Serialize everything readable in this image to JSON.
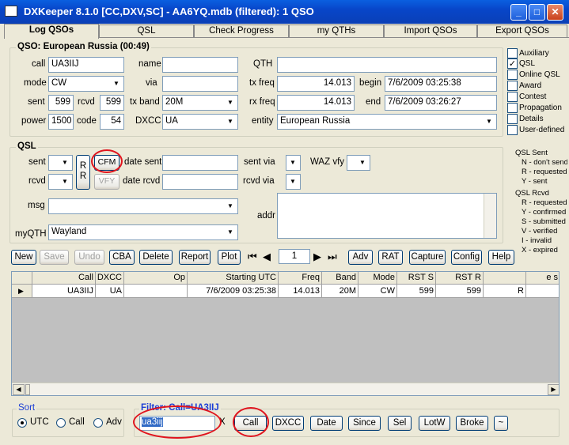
{
  "window": {
    "title": "DXKeeper 8.1.0 [CC,DXV,SC] - AA6YQ.mdb (filtered): 1 QSO"
  },
  "tabs": [
    "Log QSOs",
    "QSL",
    "Check Progress",
    "my QTHs",
    "Import QSOs",
    "Export QSOs"
  ],
  "qso": {
    "group_title": "QSO: European Russia (00:49)",
    "call_label": "call",
    "call": "UA3IIJ",
    "name_label": "name",
    "name": "",
    "qth_label": "QTH",
    "qth": "",
    "mode_label": "mode",
    "mode": "CW",
    "via_label": "via",
    "via": "",
    "txfreq_label": "tx freq",
    "txfreq": "14.013",
    "begin_label": "begin",
    "begin": "7/6/2009   03:25:38",
    "sent_label": "sent",
    "sent": "599",
    "rcvd_label": "rcvd",
    "rcvd": "599",
    "txband_label": "tx band",
    "txband": "20M",
    "rxfreq_label": "rx freq",
    "rxfreq": "14.013",
    "end_label": "end",
    "end": "7/6/2009   03:26:27",
    "power_label": "power",
    "power": "1500",
    "code_label": "code",
    "code": "54",
    "dxcc_label": "DXCC",
    "dxcc": "UA",
    "entity_label": "entity",
    "entity": "European Russia"
  },
  "checkboxes": [
    {
      "label": "Auxiliary",
      "checked": false
    },
    {
      "label": "QSL",
      "checked": true
    },
    {
      "label": "Online QSL",
      "checked": false
    },
    {
      "label": "Award",
      "checked": false
    },
    {
      "label": "Contest",
      "checked": false
    },
    {
      "label": "Propagation",
      "checked": false
    },
    {
      "label": "Details",
      "checked": false
    },
    {
      "label": "User-defined",
      "checked": false
    }
  ],
  "qsl": {
    "group_title": "QSL",
    "sent_label": "sent",
    "rcvd_label": "rcvd",
    "rr_label": "R R",
    "cfm": "CFM",
    "vfy": "VFY",
    "date_sent_label": "date sent",
    "date_rcvd_label": "date rcvd",
    "sent_via_label": "sent via",
    "rcvd_via_label": "rcvd via",
    "waz_label": "WAZ vfy",
    "msg_label": "msg",
    "addr_label": "addr",
    "myqth_label": "myQTH",
    "myqth": "Wayland"
  },
  "qsl_sent_legend": {
    "title": "QSL Sent",
    "items": [
      "N - don't send",
      "R - requested",
      "Y - sent"
    ]
  },
  "qsl_rcvd_legend": {
    "title": "QSL Rcvd",
    "items": [
      "R - requested",
      "Y - confirmed",
      "S - submitted",
      "V - verified",
      "I - invalid",
      "X - expired"
    ]
  },
  "toolbar": {
    "new": "New",
    "save": "Save",
    "undo": "Undo",
    "cba": "CBA",
    "delete": "Delete",
    "report": "Report",
    "plot": "Plot",
    "position": "1",
    "adv": "Adv",
    "rat": "RAT",
    "capture": "Capture",
    "config": "Config",
    "help": "Help"
  },
  "grid": {
    "columns": [
      "Call",
      "DXCC",
      "Op",
      "Starting UTC",
      "Freq",
      "Band",
      "Mode",
      "RST S",
      "RST R",
      "",
      "e s"
    ],
    "rows": [
      [
        "UA3IIJ",
        "UA",
        "",
        "7/6/2009   03:25:38",
        "14.013",
        "20M",
        "CW",
        "599",
        "599",
        "R",
        ""
      ]
    ]
  },
  "sort": {
    "title": "Sort",
    "options": [
      "UTC",
      "Call",
      "Adv"
    ],
    "selected": "UTC"
  },
  "filter": {
    "title": "Filter: Call=UA3IIJ",
    "value": "ua3iij",
    "clear": "X",
    "buttons": [
      "Call",
      "DXCC",
      "Date",
      "Since",
      "Sel",
      "LotW",
      "Broke",
      "~"
    ]
  },
  "colors": {
    "annotation": "#E0141E",
    "titlebar": "#0A5FE0",
    "filter_title": "#1C3FD6"
  }
}
